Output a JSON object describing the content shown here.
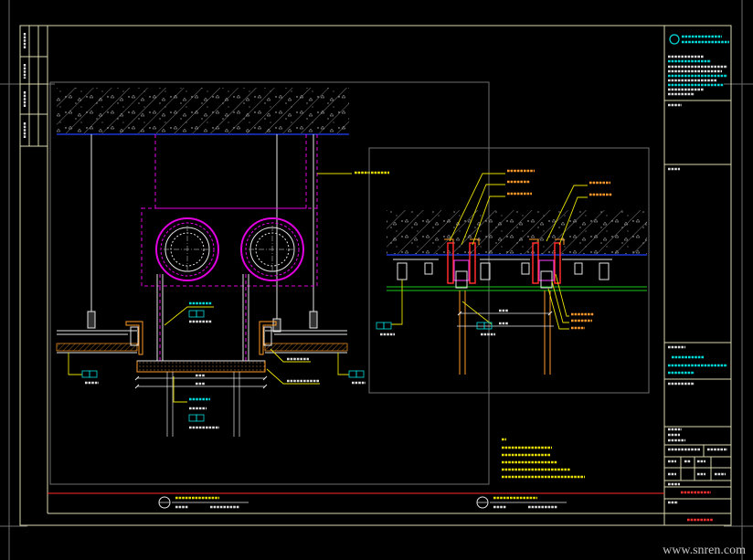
{
  "watermark": {
    "text": "www.snren.com"
  },
  "colors": {
    "background": "#000000",
    "sheet_frame": "#d9d9b0",
    "slab_soffit": "#2040ff",
    "duct_outline": "#e000e0",
    "leader_lines": "#e8e000",
    "reference_labels": "#00dcdc",
    "title_band": "#ff2a2a",
    "ceiling_finish": "#19c819",
    "profile_lines": "#ff9a2a"
  }
}
